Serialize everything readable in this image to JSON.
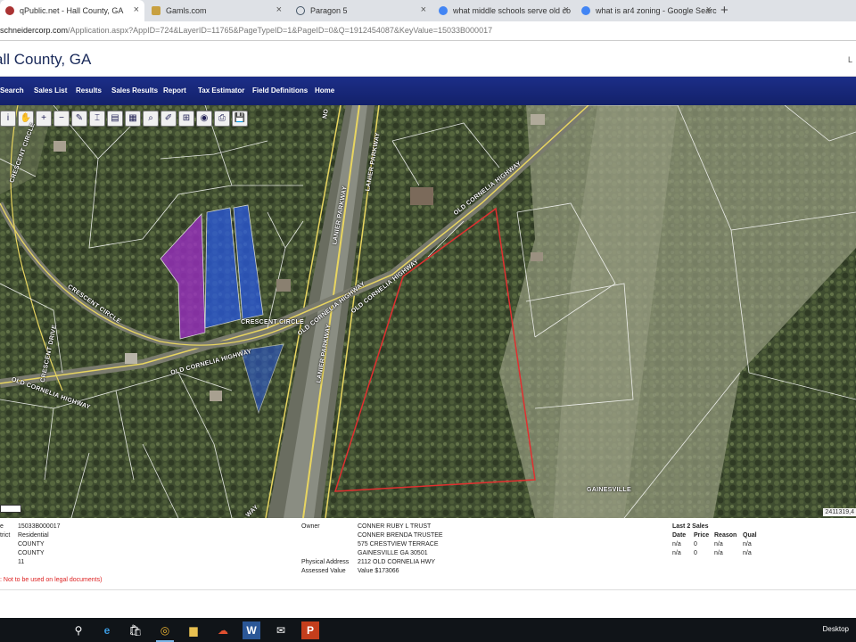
{
  "browser": {
    "tabs": [
      {
        "label": "qPublic.net - Hall County, GA",
        "active": true
      },
      {
        "label": "Gamls.com",
        "active": false
      },
      {
        "label": "Paragon 5",
        "active": false
      },
      {
        "label": "what middle schools serve old co",
        "active": false
      },
      {
        "label": "what is ar4 zoning - Google Searc",
        "active": false
      }
    ],
    "close_glyph": "×",
    "new_tab_glyph": "+",
    "url_domain": "schneidercorp.com",
    "url_path": "/Application.aspx?AppID=724&LayerID=11765&PageTypeID=1&PageID=0&Q=1912454087&KeyValue=15033B000017"
  },
  "site": {
    "title": "all County, GA",
    "user_glyph": "L"
  },
  "nav": {
    "items": [
      "Search",
      "Sales List",
      "Results",
      "Sales Results",
      "Report",
      "Tax Estimator",
      "Field Definitions",
      "Home"
    ]
  },
  "map": {
    "toolbar_icons": [
      "info-icon",
      "pan-icon",
      "zoom-in-icon",
      "zoom-out-icon",
      "draw-icon",
      "measure-icon",
      "layers-icon",
      "select-icon",
      "search-icon",
      "edit-icon",
      "grid-icon",
      "identify-icon",
      "print-icon",
      "save-icon"
    ],
    "toolbar_glyphs": [
      "i",
      "✋",
      "+",
      "−",
      "✎",
      "⌶",
      "▤",
      "▦",
      "⌕",
      "✐",
      "⊞",
      "◉",
      "⎙",
      "💾"
    ],
    "road_labels": {
      "lanier_parkway_north": "LANIER PARKWAY",
      "lanier_parkway_mid": "LANIER PARKWAY",
      "lanier_parkway_south": "LANIER PARKWAY",
      "old_cornelia_hwy_ne": "OLD CORNELIA HIGHWAY",
      "old_cornelia_hwy_center": "OLD CORNELIA HIGHWAY",
      "old_cornelia_hwy_center2": "OLD CORNELIA HIGHWAY",
      "old_cornelia_hwy_sw": "OLD CORNELIA HIGHWAY",
      "old_cornelia_hwy_west": "OLD CORNELIA HIGHWAY",
      "crescent_circle_a": "CRESCENT CIRCLE",
      "crescent_circle_b": "CRESCENT CIRCLE",
      "crescent_circle_c": "CRESCENT CIRCLE",
      "crescent_drive": "CRESCENT DRIVE",
      "gainesville": "GAINESVILLE",
      "way": "WAY",
      "no": "NO"
    },
    "coords": "2411319,4"
  },
  "parcel": {
    "labels": [
      "e",
      "trict",
      "",
      "",
      ""
    ],
    "values": [
      "15033B000017",
      "Residential",
      "COUNTY",
      "COUNTY",
      "11"
    ],
    "legal_note": ": Not to be used on legal documents)",
    "owner_label": "Owner",
    "owner_lines": [
      "CONNER RUBY L TRUST",
      "CONNER BRENDA TRUSTEE",
      "575 CRESTVIEW TERRACE",
      "GAINESVILLE GA 30501"
    ],
    "physical_address_label": "Physical Address",
    "physical_address": "2112 OLD CORNELIA HWY",
    "assessed_value_label": "Assessed Value",
    "assessed_value": "Value $173066"
  },
  "sales": {
    "title": "Last 2 Sales",
    "headers": [
      "Date",
      "Price",
      "Reason",
      "Qual"
    ],
    "rows": [
      [
        "n/a",
        "0",
        "n/a",
        "n/a"
      ],
      [
        "n/a",
        "0",
        "n/a",
        "n/a"
      ]
    ]
  },
  "taskbar": {
    "desktop_label": "Desktop",
    "icons": [
      "search-icon",
      "edge-icon",
      "store-icon",
      "chrome-icon",
      "file-explorer-icon",
      "cloud-icon",
      "word-icon",
      "mail-icon",
      "powerpoint-icon"
    ],
    "glyphs": [
      "⚲",
      "e",
      "🛍",
      "◎",
      "▆",
      "☁",
      "W",
      "✉",
      "P"
    ]
  },
  "colors": {
    "nav_bg": "#1a2a80",
    "selected_parcel": "#e03030",
    "purple_parcel": "#9a30c0",
    "blue_parcel": "#2a5ae0"
  }
}
